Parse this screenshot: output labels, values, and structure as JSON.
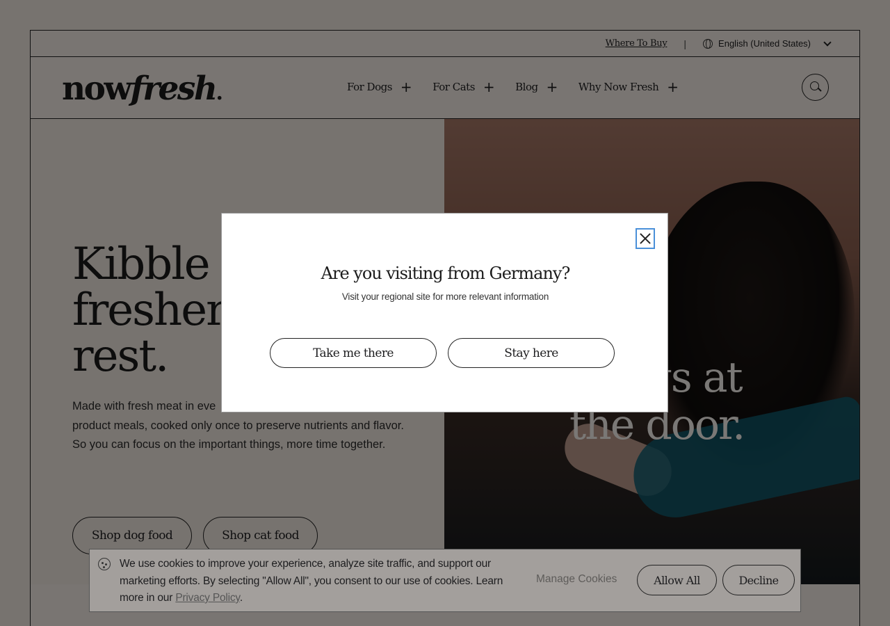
{
  "utility": {
    "where_to_buy": "Where To Buy",
    "separator": "|",
    "language": "English (United States)"
  },
  "header": {
    "logo_now": "now",
    "logo_fresh": "fresh",
    "logo_dot": ".",
    "nav": [
      {
        "label": "For Dogs"
      },
      {
        "label": "For Cats"
      },
      {
        "label": "Blog"
      },
      {
        "label": "Why Now Fresh"
      }
    ],
    "plus": "+"
  },
  "hero": {
    "title": "Kibble t\nfresher\nrest.",
    "text": "Made with fresh meat in eve\nproduct meals, cooked only once to preserve nutrients and flavor. So you can focus on the important things, more time together.",
    "buttons": [
      "Shop dog food",
      "Shop cat food"
    ],
    "right_text": "  etings at\nthe door."
  },
  "modal": {
    "title": "Are you visiting from Germany?",
    "subtitle": "Visit your regional site for more relevant information",
    "primary": "Take me there",
    "secondary": "Stay here"
  },
  "cookie": {
    "text": "We use cookies to improve your experience, analyze site traffic, and support our marketing efforts. By selecting \"Allow All\", you consent to our use of cookies. Learn more in our ",
    "link": "Privacy Policy",
    "end": ".",
    "manage": "Manage Cookies",
    "allow": "Allow All",
    "decline": "Decline"
  }
}
